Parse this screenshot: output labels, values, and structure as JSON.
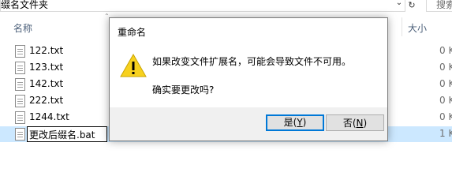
{
  "explorer": {
    "address_path": "缀名文件夹",
    "search_placeholder": "搜索",
    "columns": {
      "name": "名称",
      "size": "大小"
    },
    "files": [
      {
        "name": "122.txt",
        "size": "0 K"
      },
      {
        "name": "123.txt",
        "size": "0 K"
      },
      {
        "name": "142.txt",
        "size": "0 K"
      },
      {
        "name": "222.txt",
        "size": "0 K"
      },
      {
        "name": "1244.txt",
        "size": "0 K"
      },
      {
        "name": "更改后缀名.bat",
        "size": "1 K",
        "selected": true,
        "renaming": true
      }
    ]
  },
  "dialog": {
    "title": "重命名",
    "message": "如果改变文件扩展名，可能会导致文件不可用。",
    "question": "确实要更改吗?",
    "icon": "warning-icon",
    "buttons": {
      "yes": {
        "label": "是(",
        "key": "Y",
        "close": ")"
      },
      "no": {
        "label": "否(",
        "key": "N",
        "close": ")"
      }
    }
  }
}
